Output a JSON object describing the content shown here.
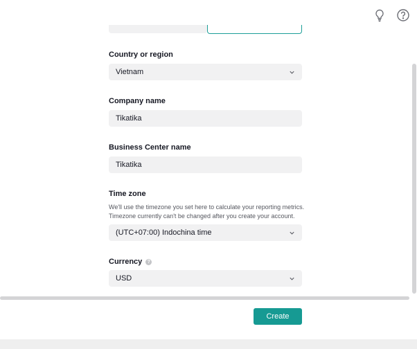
{
  "top_icons": [
    {
      "icon": "lightbulb-icon"
    },
    {
      "icon": "question-circle-icon"
    }
  ],
  "form": {
    "country": {
      "label": "Country or region",
      "value": "Vietnam"
    },
    "company": {
      "label": "Company name",
      "value": "Tikatika"
    },
    "business_center": {
      "label": "Business Center name",
      "value": "Tikatika"
    },
    "timezone": {
      "label": "Time zone",
      "help_line1": "We'll use the timezone you set here to calculate your reporting metrics.",
      "help_line2": "Timezone currently can't be changed after you create your account.",
      "value": "(UTC+07:00) Indochina time"
    },
    "currency": {
      "label": "Currency",
      "info_icon": "?",
      "value": "USD"
    }
  },
  "actions": {
    "create_label": "Create"
  },
  "colors": {
    "accent": "#169a93",
    "field_bg": "#f1f1f2",
    "text": "#161823"
  }
}
